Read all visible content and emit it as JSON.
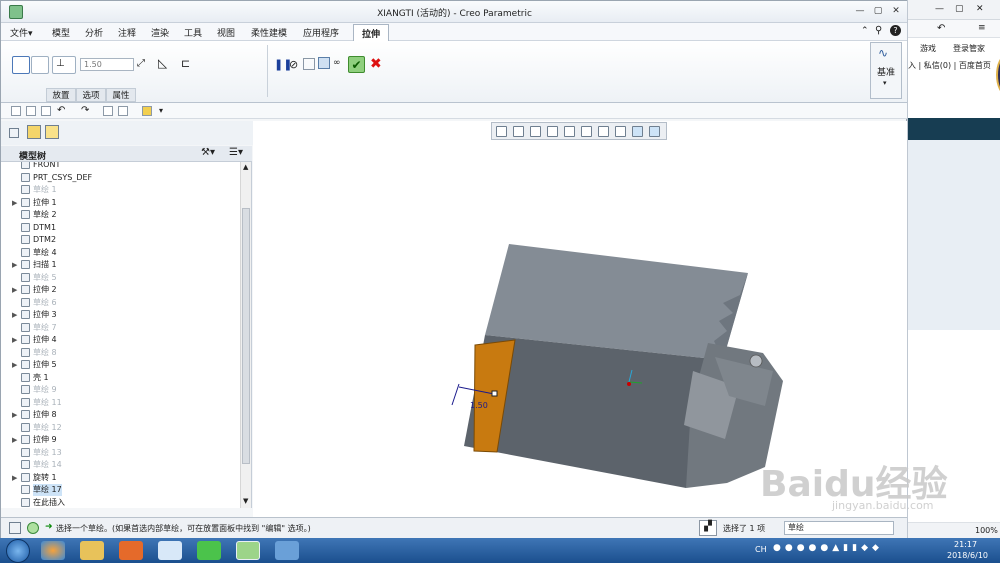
{
  "window": {
    "title": "XIANGTI (活动的) - Creo Parametric",
    "controls": {
      "min": "—",
      "max": "▢",
      "close": "✕"
    }
  },
  "menu": {
    "items": [
      "文件▾",
      "模型",
      "分析",
      "注释",
      "渲染",
      "工具",
      "视图",
      "柔性建模",
      "应用程序"
    ],
    "active": "拉伸"
  },
  "ribbon": {
    "depth_value": "1.50",
    "tabs": [
      "放置",
      "选项",
      "属性"
    ],
    "datum_label": "基准"
  },
  "left_panel": {
    "header": "模型树"
  },
  "tree": [
    {
      "label": "FRONT",
      "dim": false,
      "expander": false
    },
    {
      "label": "PRT_CSYS_DEF",
      "dim": false,
      "expander": false
    },
    {
      "label": "草绘 1",
      "dim": true,
      "expander": false
    },
    {
      "label": "拉伸 1",
      "dim": false,
      "expander": true
    },
    {
      "label": "草绘 2",
      "dim": false,
      "expander": false
    },
    {
      "label": "DTM1",
      "dim": false,
      "expander": false
    },
    {
      "label": "DTM2",
      "dim": false,
      "expander": false
    },
    {
      "label": "草绘 4",
      "dim": false,
      "expander": false
    },
    {
      "label": "扫描 1",
      "dim": false,
      "expander": true
    },
    {
      "label": "草绘 5",
      "dim": true,
      "expander": false
    },
    {
      "label": "拉伸 2",
      "dim": false,
      "expander": true
    },
    {
      "label": "草绘 6",
      "dim": true,
      "expander": false
    },
    {
      "label": "拉伸 3",
      "dim": false,
      "expander": true
    },
    {
      "label": "草绘 7",
      "dim": true,
      "expander": false
    },
    {
      "label": "拉伸 4",
      "dim": false,
      "expander": true
    },
    {
      "label": "草绘 8",
      "dim": true,
      "expander": false
    },
    {
      "label": "拉伸 5",
      "dim": false,
      "expander": true
    },
    {
      "label": "壳 1",
      "dim": false,
      "expander": false
    },
    {
      "label": "草绘 9",
      "dim": true,
      "expander": false
    },
    {
      "label": "草绘 11",
      "dim": true,
      "expander": false
    },
    {
      "label": "拉伸 8",
      "dim": false,
      "expander": true
    },
    {
      "label": "草绘 12",
      "dim": true,
      "expander": false
    },
    {
      "label": "拉伸 9",
      "dim": false,
      "expander": true
    },
    {
      "label": "草绘 13",
      "dim": true,
      "expander": false
    },
    {
      "label": "草绘 14",
      "dim": true,
      "expander": false
    },
    {
      "label": "旋转 1",
      "dim": false,
      "expander": true
    },
    {
      "label": "草绘 17",
      "dim": false,
      "expander": false,
      "selected": true
    },
    {
      "label": "在此插入",
      "dim": false,
      "expander": false
    }
  ],
  "viewport": {
    "dimension_label": "1.50"
  },
  "status": {
    "message": "选择一个草绘。(如果首选内部草绘，可在放置面板中找到 \"编辑\" 选项。)",
    "selection": "选择了 1 项",
    "filter": "草绘"
  },
  "browser": {
    "toolbar_text": "游戏",
    "login": "登录管家",
    "nav_text": "入 | 私信(0) | 百度首页",
    "zoom": "100%"
  },
  "taskbar": {
    "time": "21:17",
    "date": "2018/6/10",
    "lang": "CH"
  },
  "watermark": {
    "text": "Baidu经验",
    "url": "jingyan.baidu.com"
  }
}
